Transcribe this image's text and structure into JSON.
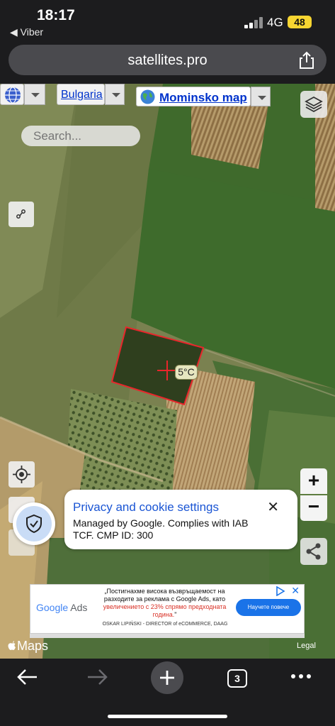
{
  "status_bar": {
    "time": "18:17",
    "back_app": "◀ Viber",
    "network": "4G",
    "battery": "48"
  },
  "browser": {
    "url": "satellites.pro"
  },
  "map": {
    "country": "Bulgaria",
    "place": "Mominsko map",
    "search_placeholder": "Search...",
    "temperature": "5°C",
    "zoom_in": "+",
    "zoom_out": "−",
    "attribution": "Maps",
    "legal": "Legal"
  },
  "privacy": {
    "title": "Privacy and cookie settings",
    "body": "Managed by Google. Complies with IAB TCF. CMP ID: 300",
    "close": "✕"
  },
  "ad": {
    "brand": "Google Ads",
    "text_part1": "„Постигнахме висока възвръщаемост на разходите за реклама с Google Ads, като ",
    "text_highlight": "увеличението с 23% спрямо предходната година.",
    "text_part2": "\"",
    "attribution": "OSKAR LIPIŃSKI - DIRECTOR of eCOMMERCE, DAAG",
    "cta": "Научете повече",
    "close": "✕"
  },
  "toolbar": {
    "tab_count": "3"
  },
  "colors": {
    "accent_blue": "#1a55d4",
    "field_red": "#e8262b",
    "battery_yellow": "#f7d531"
  }
}
